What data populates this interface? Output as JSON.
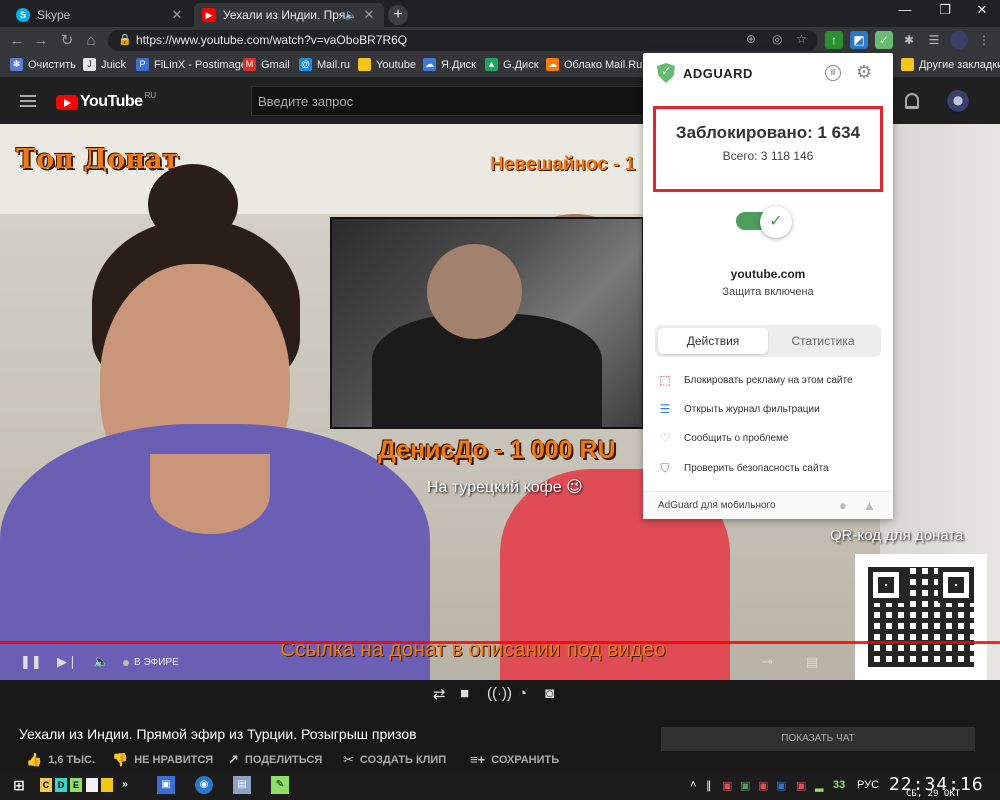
{
  "tabs": [
    {
      "title": "Skype",
      "close": "✕"
    },
    {
      "title": "Уехали из Индии. Прямой э",
      "close": "✕"
    }
  ],
  "window": {
    "minimize": "—",
    "restore": "❐",
    "close": "✕"
  },
  "address": {
    "url": "https://www.youtube.com/watch?v=vaOboBR7R6Q"
  },
  "bookmarks": [
    {
      "label": "Очистить",
      "color": "#5a7ad9",
      "glyph": "✽"
    },
    {
      "label": "Juick",
      "color": "#e6e6e6",
      "glyph": "J"
    },
    {
      "label": "FiLinX - Postimage",
      "color": "#3b6fd3",
      "glyph": "P"
    },
    {
      "label": "Gmail",
      "color": "#d93025",
      "glyph": "M"
    },
    {
      "label": "Mail.ru",
      "color": "#168de2",
      "glyph": "@"
    },
    {
      "label": "Youtube",
      "color": "#f5c518",
      "glyph": ""
    },
    {
      "label": "Я.Диск",
      "color": "#3a7bd5",
      "glyph": "☁"
    },
    {
      "label": "G.Диск",
      "color": "#1fa463",
      "glyph": "▲"
    },
    {
      "label": "Облако Mail.Ru",
      "color": "#ff7a00",
      "glyph": "☁"
    },
    {
      "label": "Другие закладки",
      "color": "#f5c518",
      "glyph": ""
    }
  ],
  "youtube": {
    "logo": "YouTube",
    "region": "RU",
    "search_placeholder": "Введите запрос"
  },
  "video": {
    "overlay_top": "Топ Донат",
    "overlay_nev": "Невешайнос - 1",
    "overlay_den": "ДенисДо - 1 000 RU",
    "overlay_coffee": "На турецкий кофе 😉",
    "overlay_qr": "QR-код для доната",
    "overlay_link": "Ссылка на донат в описании под видео",
    "live_label": "В ЭФИРЕ"
  },
  "meta": {
    "title": "Уехали из Индии. Прямой эфир из Турции. Розыгрыш призов",
    "likes": "1,6 ТЫС.",
    "dislike": "НЕ НРАВИТСЯ",
    "share": "ПОДЕЛИТЬСЯ",
    "clip": "СОЗДАТЬ КЛИП",
    "save": "СОХРАНИТЬ",
    "show_chat": "ПОКАЗАТЬ ЧАТ"
  },
  "adguard": {
    "name": "ADGUARD",
    "blocked": "Заблокировано: 1 634",
    "total": "Всего: 3 118 146",
    "site": "youtube.com",
    "protection": "Защита включена",
    "tab_actions": "Действия",
    "tab_stats": "Статистика",
    "actions": [
      {
        "label": "Блокировать рекламу на этом сайте",
        "icon": "cursor-icon",
        "color": "#e0262f",
        "glyph": "⬚"
      },
      {
        "label": "Открыть журнал фильтрации",
        "icon": "list-icon",
        "color": "#3b7ddd",
        "glyph": "☰"
      },
      {
        "label": "Сообщить о проблеме",
        "icon": "thumb-down-icon",
        "color": "#f0a020",
        "glyph": "♡"
      },
      {
        "label": "Проверить безопасность сайта",
        "icon": "shield-icon",
        "color": "#4d9d5c",
        "glyph": "⛉"
      }
    ],
    "footer": "AdGuard для мобильного",
    "toggle_enabled": true
  },
  "taskbar": {
    "clock": "22:34:16",
    "date": "СБ, 29 ОКТ",
    "lang": "РУС",
    "tray_number": "33",
    "chevron": "»"
  },
  "colors": {
    "youtube_red": "#ff0000",
    "adguard_green": "#68bc71",
    "overlay_orange": "#f07b12",
    "highlight_red": "#e0262f"
  }
}
